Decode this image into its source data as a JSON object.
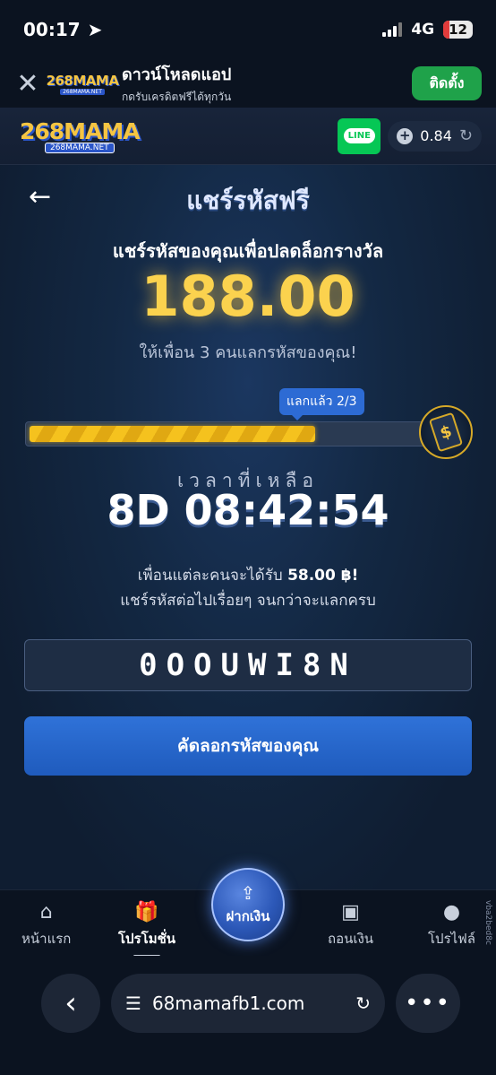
{
  "status_bar": {
    "time": "00:17",
    "network": "4G",
    "battery": "12"
  },
  "app_banner": {
    "logo_main": "268MAMA",
    "logo_sub": "268MAMA.NET",
    "title": "ดาวน์โหลดแอป",
    "subtitle": "กดรับเครดิตฟรีได้ทุกวัน",
    "install_label": "ติดตั้ง"
  },
  "header": {
    "logo_main": "268MAMA",
    "logo_sub": "268MAMA.NET",
    "line_label": "LINE",
    "balance": "0.84"
  },
  "page": {
    "title": "แชร์รหัสฟรี",
    "subtitle": "แชร์รหัสของคุณเพื่อปลดล็อกรางวัล",
    "reward_amount": "188.00",
    "invite_text": "ให้เพื่อน 3 คนแลกรหัสของคุณ!",
    "progress": {
      "label": "แลกแล้ว 2/3",
      "fraction": 0.667
    },
    "time_label": "เวลาที่เหลือ",
    "countdown": "8D 08:42:54",
    "friend_reward_prefix": "เพื่อนแต่ละคนจะได้รับ",
    "friend_reward_amount": "58.00 ฿!",
    "share_more_text": "แชร์รหัสต่อไปเรื่อยๆ จนกว่าจะแลกครบ",
    "code": "0OOUWI8N",
    "copy_button": "คัดลอกรหัสของคุณ"
  },
  "bottom_nav": {
    "home": "หน้าแรก",
    "promotions": "โปรโมชั่น",
    "deposit": "ฝากเงิน",
    "withdraw": "ถอนเงิน",
    "profile": "โปรไฟล์",
    "side_tag": "vba2bed8c"
  },
  "browser": {
    "url": "68mamafb1.com"
  }
}
